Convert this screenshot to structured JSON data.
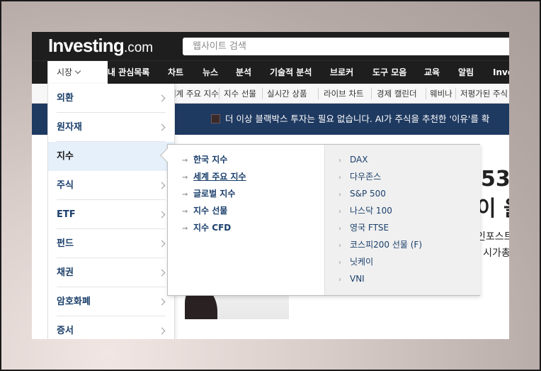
{
  "header": {
    "logo_brand": "Investing",
    "logo_tld": ".com",
    "search_placeholder": "웹사이트 검색"
  },
  "nav": {
    "market_label": "시장",
    "watchlist_label": "★ 내 관심목록",
    "items": [
      "차트",
      "뉴스",
      "분석",
      "기술적 분석",
      "브로커",
      "도구 모음",
      "교육",
      "알림",
      "Inve"
    ]
  },
  "subnav": {
    "items": [
      "세계 주요 지수",
      "지수 선물",
      "실시간 상품",
      "라이브 차트",
      "경제 캘린더",
      "웨비나",
      "저평가된 주식"
    ]
  },
  "banner": {
    "text": "더 이상 블랙박스 투자는 필요 없습니다. AI가 주식을 추천한 '이유'를 확"
  },
  "article": {
    "num": "53",
    "line2": "이 을",
    "sm1": "인포스트",
    "sm2": "| 시가총"
  },
  "left_menu": {
    "items": [
      "외환",
      "원자재",
      "지수",
      "주식",
      "ETF",
      "펀드",
      "채권",
      "암호화폐",
      "증서"
    ],
    "selected": "지수"
  },
  "submenu": {
    "left": [
      "한국 지수",
      "세계 주요 지수",
      "글로벌 지수",
      "지수 선물",
      "지수 CFD"
    ],
    "right": [
      "DAX",
      "다우존스",
      "S&P 500",
      "나스닥 100",
      "영국 FTSE",
      "코스피200 선물 (F)",
      "닛케이",
      "VNI"
    ]
  }
}
